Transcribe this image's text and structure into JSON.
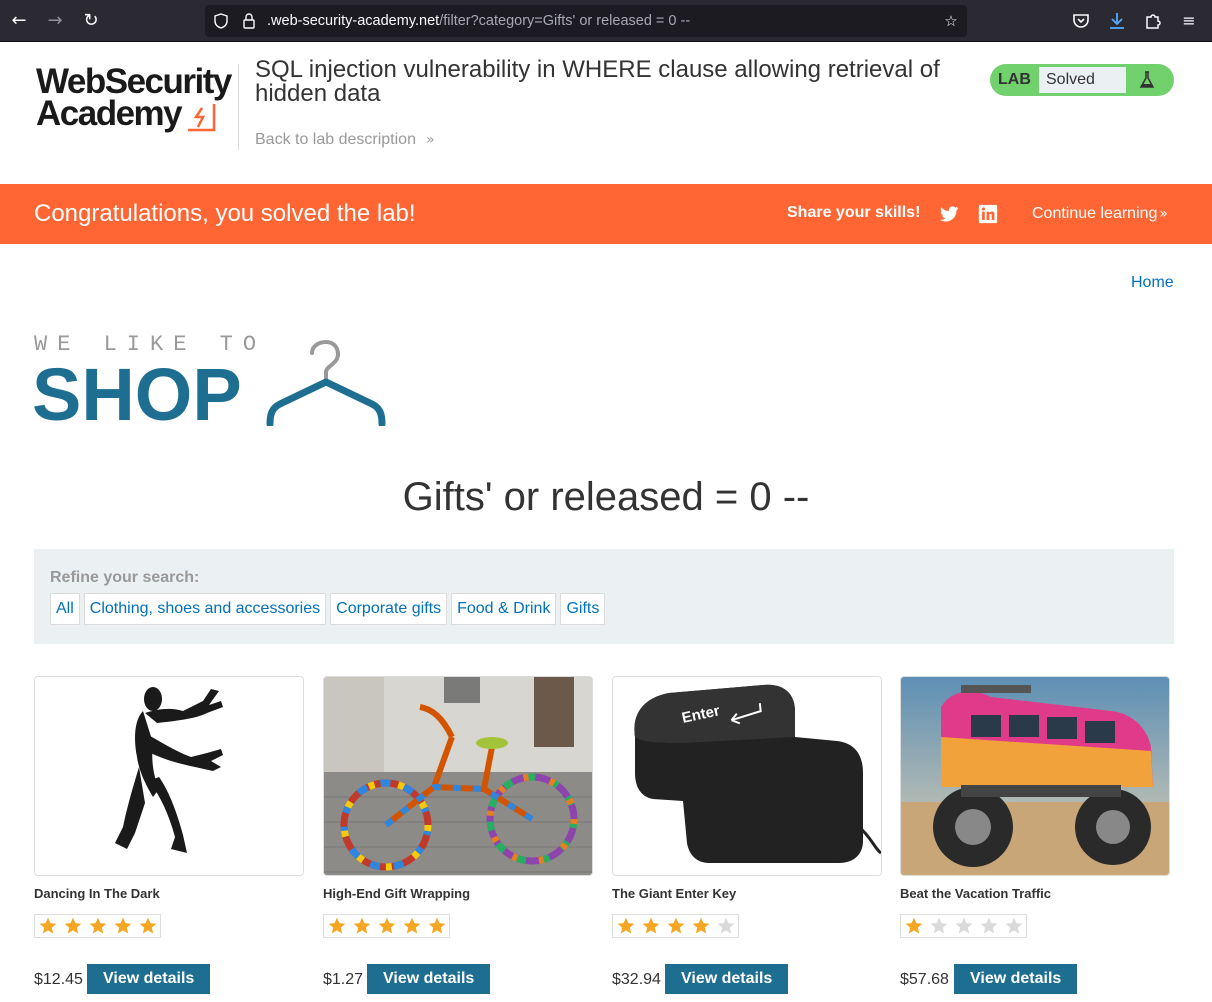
{
  "browser": {
    "url_domain": ".web-security-academy.net",
    "url_path": "/filter?category=Gifts' or released = 0 --"
  },
  "lab": {
    "logo_line1": "WebSecurity",
    "logo_line2": "Academy",
    "title": "SQL injection vulnerability in WHERE clause allowing retrieval of hidden data",
    "back_link": "Back to lab description",
    "status_tag": "LAB",
    "status_value": "Solved"
  },
  "banner": {
    "message": "Congratulations, you solved the lab!",
    "share_label": "Share your skills!",
    "continue_label": "Continue learning"
  },
  "nav": {
    "home": "Home"
  },
  "shop_logo": {
    "tagline": "WE LIKE TO",
    "word": "SHOP"
  },
  "page": {
    "heading": "Gifts' or released = 0 --"
  },
  "filter": {
    "label": "Refine your search:",
    "categories": [
      "All",
      "Clothing, shoes and accessories",
      "Corporate gifts",
      "Food & Drink",
      "Gifts"
    ]
  },
  "products": [
    {
      "name": "Dancing In The Dark",
      "rating": 5,
      "price": "$12.45",
      "button": "View details",
      "image": "dancing-silhouette"
    },
    {
      "name": "High-End Gift Wrapping",
      "rating": 5,
      "price": "$1.27",
      "button": "View details",
      "image": "knitted-bicycle"
    },
    {
      "name": "The Giant Enter Key",
      "rating": 4,
      "price": "$32.94",
      "button": "View details",
      "image": "giant-enter-key"
    },
    {
      "name": "Beat the Vacation Traffic",
      "rating": 1,
      "price": "$57.68",
      "button": "View details",
      "image": "monster-van"
    }
  ],
  "colors": {
    "accent_orange": "#ff6633",
    "brand_blue": "#1e6e91",
    "link_blue": "#0071bc",
    "lab_green": "#70d16d",
    "star_gold": "#f5a623"
  }
}
